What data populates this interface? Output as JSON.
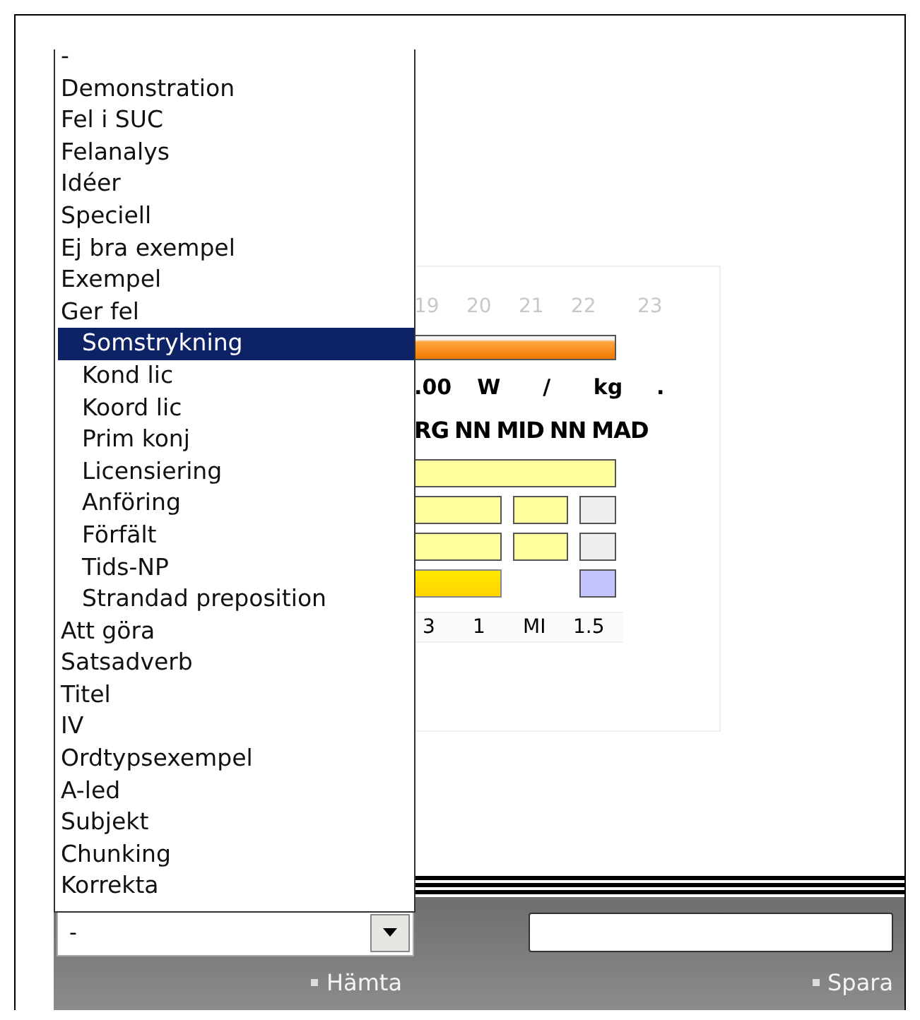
{
  "panel": {
    "hours": [
      "19",
      "20",
      "21",
      "22",
      "23"
    ],
    "units": [
      ".00",
      "W",
      "/",
      "kg",
      "."
    ],
    "tags": [
      "RG",
      "NN",
      "MID",
      "NN",
      "MAD"
    ],
    "bar_rows": [
      [
        {
          "kind": "wide"
        }
      ],
      [
        {
          "kind": "yellow"
        },
        {
          "kind": "yellow"
        },
        {
          "kind": "gray"
        }
      ],
      [
        {
          "kind": "yellow"
        },
        {
          "kind": "yellow"
        },
        {
          "kind": "gray"
        }
      ],
      [
        {
          "kind": "gold"
        },
        {
          "kind": "empty"
        },
        {
          "kind": "lavender"
        }
      ]
    ],
    "values": [
      "3",
      "1",
      "MI",
      "1.5"
    ]
  },
  "dropdown_list": {
    "items": [
      {
        "label": "-",
        "selected": false
      },
      {
        "label": "Demonstration",
        "selected": false
      },
      {
        "label": "Fel i SUC",
        "selected": false
      },
      {
        "label": "Felanalys",
        "selected": false
      },
      {
        "label": "Idéer",
        "selected": false
      },
      {
        "label": "Speciell",
        "selected": false
      },
      {
        "label": "Ej bra exempel",
        "selected": false
      },
      {
        "label": "Exempel",
        "selected": false
      },
      {
        "label": "Ger fel",
        "selected": false,
        "children": [
          {
            "label": "Somstrykning",
            "selected": true
          },
          {
            "label": "Kond lic",
            "selected": false
          },
          {
            "label": "Koord lic",
            "selected": false
          },
          {
            "label": "Prim konj",
            "selected": false
          },
          {
            "label": "Licensiering",
            "selected": false
          },
          {
            "label": "Anföring",
            "selected": false
          },
          {
            "label": "Förfält",
            "selected": false
          },
          {
            "label": "Tids-NP",
            "selected": false
          },
          {
            "label": "Strandad preposition",
            "selected": false
          }
        ]
      },
      {
        "label": "Att göra",
        "selected": false
      },
      {
        "label": "Satsadverb",
        "selected": false
      },
      {
        "label": "Titel",
        "selected": false
      },
      {
        "label": "IV",
        "selected": false
      },
      {
        "label": "Ordtypsexempel",
        "selected": false
      },
      {
        "label": "A-led",
        "selected": false
      },
      {
        "label": "Subjekt",
        "selected": false
      },
      {
        "label": "Chunking",
        "selected": false
      },
      {
        "label": "Korrekta",
        "selected": false
      }
    ]
  },
  "select": {
    "value": "-"
  },
  "links": [
    "Hämta",
    "Spara"
  ]
}
